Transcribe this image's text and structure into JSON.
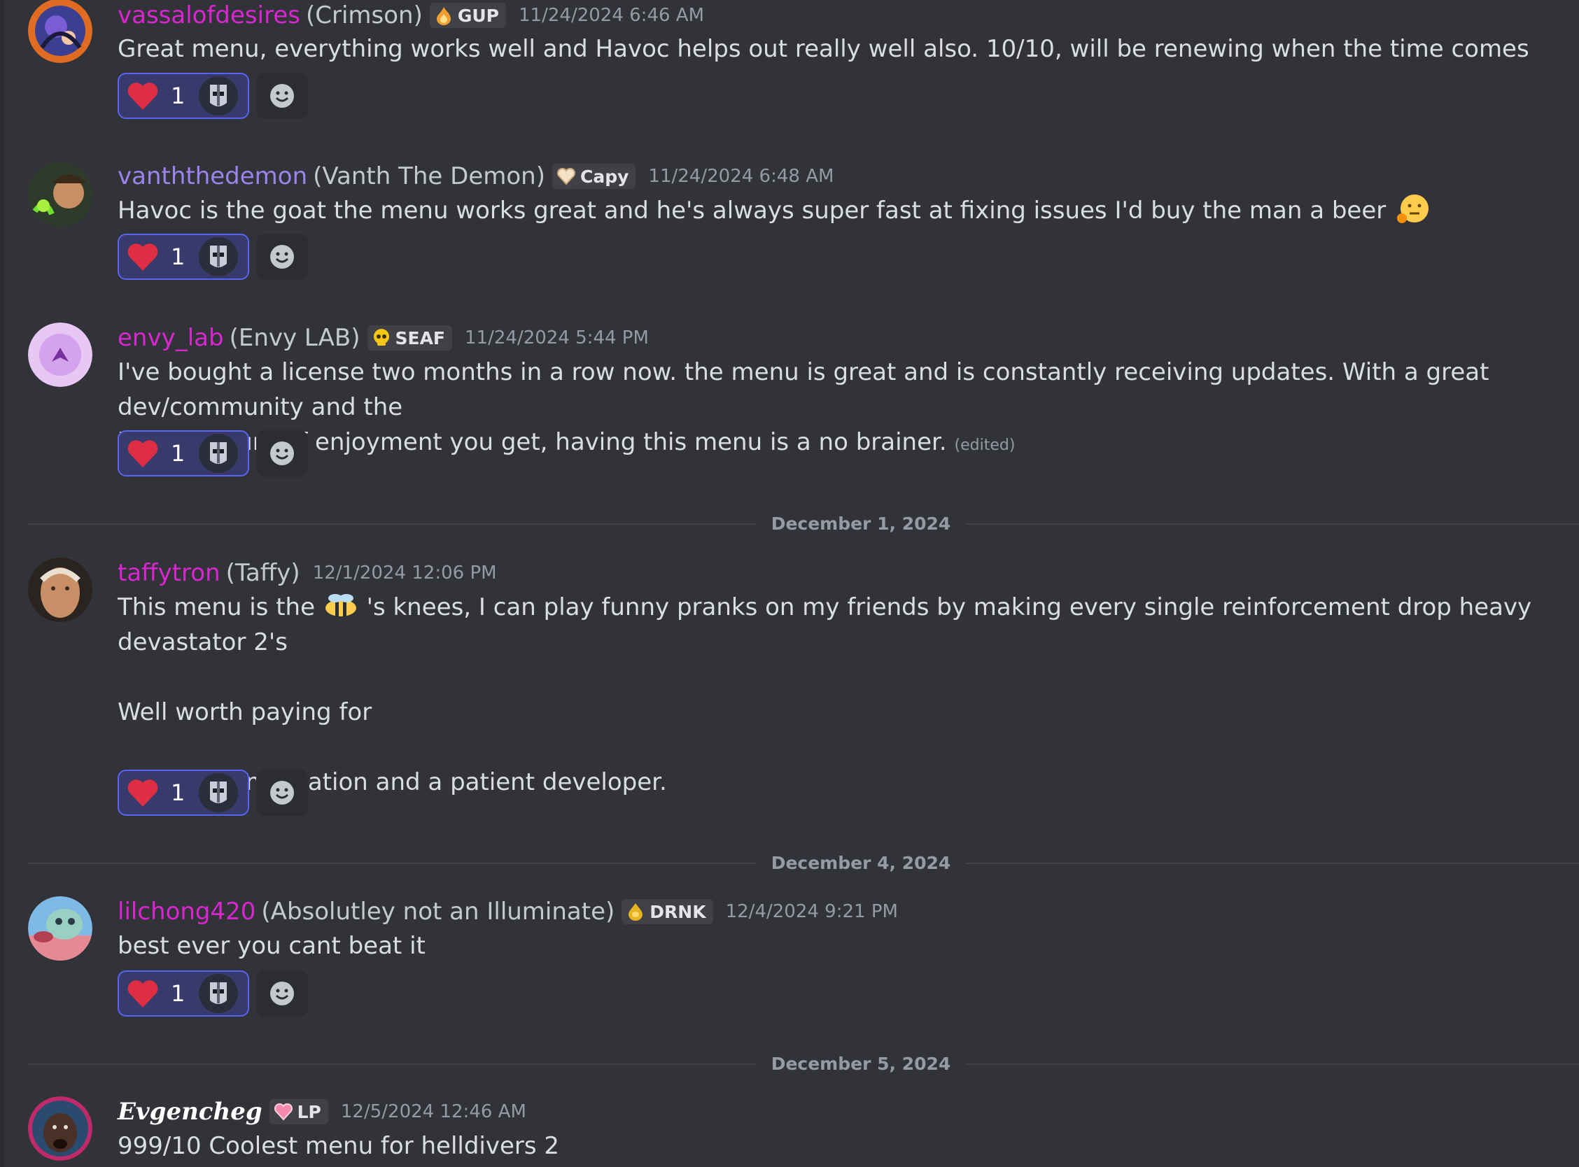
{
  "colors": {
    "background": "#313338",
    "username_pink": "#d926d0",
    "username_purple": "#9c84ec",
    "reaction_border": "#5865f2",
    "timestamp": "#949ba4"
  },
  "messages": [
    {
      "username": "vassalofdesires",
      "nickname": "(Crimson)",
      "tag": "GUP",
      "tag_icon": "flame-icon",
      "timestamp": "11/24/2024 6:46 AM",
      "lines": [
        "Great menu, everything works well and Havoc helps out really well also. 10/10, will be renewing when the time comes"
      ],
      "reaction": {
        "emoji": "heart-icon",
        "count": "1"
      }
    },
    {
      "username": "vanththedemon",
      "nickname": "(Vanth The Demon)",
      "tag": "Capy",
      "tag_icon": "heart-badge-icon",
      "timestamp": "11/24/2024 6:48 AM",
      "lines": [
        "Havoc is the goat the menu works great and he's always super fast at fixing issues I'd buy the man a beer"
      ],
      "inline_emoji": "face-holding-back-icon",
      "reaction": {
        "emoji": "heart-icon",
        "count": "1"
      }
    },
    {
      "username": "envy_lab",
      "nickname": "(Envy LAB)",
      "tag": "SEAF",
      "tag_icon": "skull-icon",
      "timestamp": "11/24/2024 5:44 PM",
      "lines": [
        "I've bought a license two months in a row now. the menu is great and is constantly receiving updates. With a great dev/community and the",
        "huge amount of enjoyment you get, having this menu is a no brainer."
      ],
      "edited": "(edited)",
      "reaction": {
        "emoji": "heart-icon",
        "count": "1"
      }
    },
    {
      "username": "taffytron",
      "nickname": "(Taffy)",
      "timestamp": "12/1/2024 12:06 PM",
      "line_prefix": "This menu is the",
      "inline_emoji": "bee-icon",
      "line_suffix": "'s knees, I can play funny pranks on my friends by making every single reinforcement drop heavy devastator 2's",
      "lines": [
        "",
        "Well worth paying for",
        "",
        "Good documentation and a patient developer."
      ],
      "reaction": {
        "emoji": "heart-icon",
        "count": "1"
      }
    },
    {
      "username": "lilchong420",
      "nickname": "(Absolutley not an Illuminate)",
      "tag": "DRNK",
      "tag_icon": "drop-icon",
      "timestamp": "12/4/2024 9:21 PM",
      "lines": [
        "best ever you cant beat it"
      ],
      "reaction": {
        "emoji": "heart-icon",
        "count": "1"
      }
    },
    {
      "username": "Evgencheg",
      "tag": "LP",
      "tag_icon": "pink-heart-icon",
      "timestamp": "12/5/2024 12:46 AM",
      "lines": [
        "999/10 Coolest menu for helldivers 2"
      ]
    }
  ],
  "dividers": [
    "December 1, 2024",
    "December 4, 2024",
    "December 5, 2024"
  ]
}
